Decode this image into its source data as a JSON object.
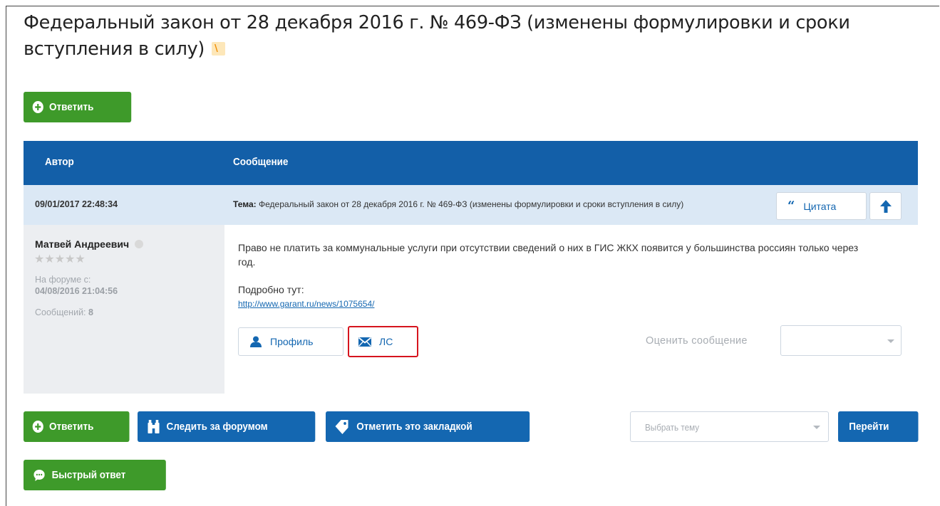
{
  "topic": {
    "title": "Федеральный закон от 28 декабря 2016 г. № 469-ФЗ (изменены формулировки и сроки вступления в силу)",
    "rss_icon": "rss-icon"
  },
  "actions_top": {
    "reply_label": "Ответить"
  },
  "table": {
    "col_author": "Автор",
    "col_message": "Сообщение"
  },
  "post": {
    "datetime": "09/01/2017 22:48:34",
    "subject_label": "Тема:",
    "subject_text": "Федеральный закон от 28 декабря 2016 г. № 469-ФЗ (изменены формулировки и сроки вступления в силу)",
    "quote_label": "Цитата",
    "author": {
      "name": "Матвей Андреевич",
      "stars": "★★★★★",
      "on_forum_since_label": "На форуме с:",
      "on_forum_since": "04/08/2016 21:04:56",
      "posts_label": "Сообщений:",
      "posts_count": "8"
    },
    "text": "Право не платить за коммунальные услуги при отсутствии сведений о них в ГИС ЖКХ появится у большинства россиян только через год.",
    "more_label": "Подробно тут:",
    "link": "http://www.garant.ru/news/1075654/",
    "profile_label": "Профиль",
    "pm_label": "ЛС",
    "rate_label": "Оценить сообщение",
    "rate_value": ""
  },
  "actions_bottom": {
    "reply_label": "Ответить",
    "watch_label": "Следить за форумом",
    "bookmark_label": "Отметить это закладкой",
    "topic_select_placeholder": "Выбрать тему",
    "go_label": "Перейти",
    "quick_reply_label": "Быстрый ответ"
  },
  "colors": {
    "green": "#3e9a2a",
    "blue": "#1467b1",
    "header_blue": "#135fa8",
    "meta_row": "#dbe8f5",
    "highlight_red": "#d6141e"
  }
}
